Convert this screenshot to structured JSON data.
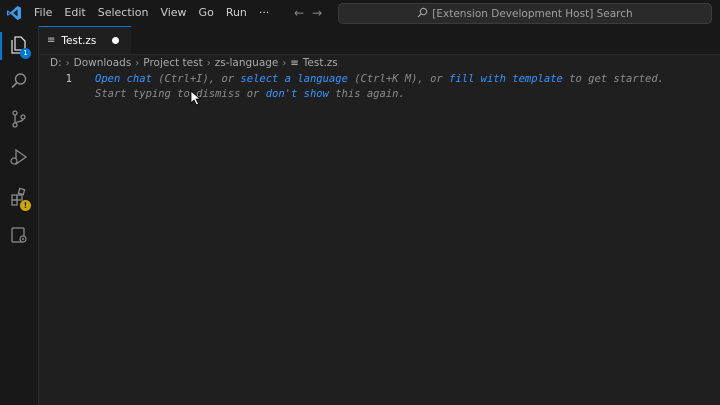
{
  "titlebar": {
    "menu": [
      "File",
      "Edit",
      "Selection",
      "View",
      "Go",
      "Run",
      "···"
    ],
    "search_text": "[Extension Development Host] Search"
  },
  "activity": {
    "explorer_badge": "1",
    "extensions_warning": "!"
  },
  "tab": {
    "label": "Test.zs"
  },
  "breadcrumb": {
    "items": [
      "D:",
      "Downloads",
      "Project test",
      "zs-language",
      "Test.zs"
    ]
  },
  "editor": {
    "line_number": "1",
    "hint_line1": {
      "open_chat": "Open chat",
      "shortcut_chat": " (Ctrl+I), or ",
      "select_language": "select a language",
      "shortcut_lang": " (Ctrl+K M), or ",
      "fill_template": "fill with template",
      "tail": " to get started."
    },
    "hint_line2": {
      "start": "Start typing to dismiss or ",
      "dont_show": "don't show",
      "tail": " this again."
    }
  },
  "colors": {
    "accent": "#0078d4",
    "link": "#3794ff",
    "warning": "#cca700"
  }
}
